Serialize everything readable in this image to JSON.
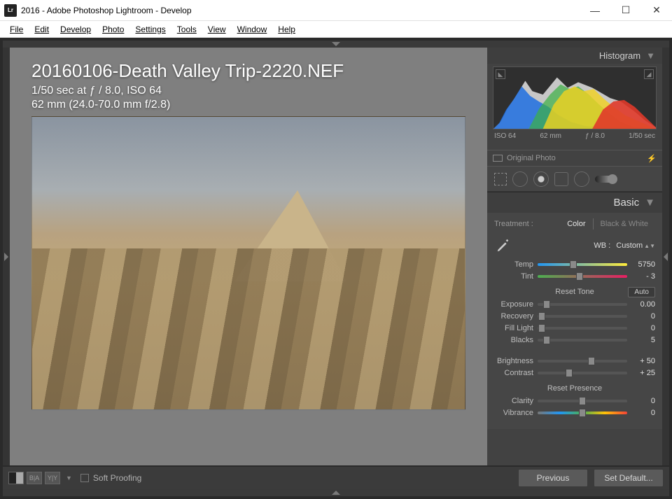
{
  "window": {
    "title": "2016 - Adobe Photoshop Lightroom - Develop",
    "app_icon_text": "Lr"
  },
  "menu": [
    "File",
    "Edit",
    "Develop",
    "Photo",
    "Settings",
    "Tools",
    "View",
    "Window",
    "Help"
  ],
  "photo": {
    "filename": "20160106-Death Valley Trip-2220.NEF",
    "exif_line1": "1/50 sec at ƒ / 8.0, ISO 64",
    "exif_line2": "62 mm (24.0-70.0 mm f/2.8)"
  },
  "histogram": {
    "title": "Histogram",
    "meta": {
      "iso": "ISO 64",
      "focal": "62 mm",
      "aperture": "ƒ / 8.0",
      "shutter": "1/50 sec"
    },
    "original_label": "Original Photo"
  },
  "basic": {
    "title": "Basic",
    "treatment_label": "Treatment :",
    "treatment_options": {
      "color": "Color",
      "bw": "Black & White"
    },
    "treatment_active": "color",
    "wb_label": "WB :",
    "wb_value": "Custom",
    "sliders_wb": [
      {
        "name": "Temp",
        "value": "5750",
        "pos": 40,
        "track": "temp"
      },
      {
        "name": "Tint",
        "value": "- 3",
        "pos": 47,
        "track": "tint"
      }
    ],
    "tone_header": "Reset Tone",
    "auto_label": "Auto",
    "sliders_tone": [
      {
        "name": "Exposure",
        "value": "0.00",
        "pos": 10
      },
      {
        "name": "Recovery",
        "value": "0",
        "pos": 5
      },
      {
        "name": "Fill Light",
        "value": "0",
        "pos": 5
      },
      {
        "name": "Blacks",
        "value": "5",
        "pos": 10
      }
    ],
    "sliders_bc": [
      {
        "name": "Brightness",
        "value": "+ 50",
        "pos": 60
      },
      {
        "name": "Contrast",
        "value": "+ 25",
        "pos": 35
      }
    ],
    "presence_header": "Reset Presence",
    "sliders_presence": [
      {
        "name": "Clarity",
        "value": "0",
        "pos": 50,
        "track": ""
      },
      {
        "name": "Vibrance",
        "value": "0",
        "pos": 50,
        "track": "vib"
      }
    ]
  },
  "toolbar": {
    "soft_proofing": "Soft Proofing",
    "previous": "Previous",
    "set_default": "Set Default..."
  }
}
